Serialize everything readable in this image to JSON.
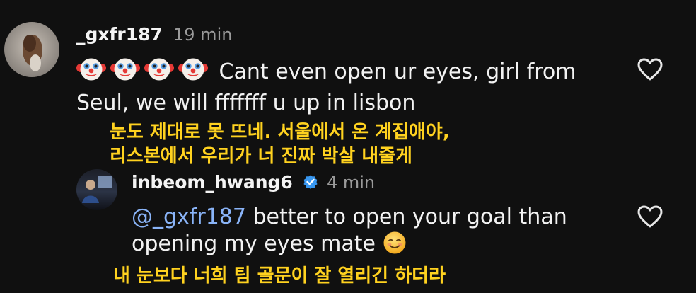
{
  "comments": [
    {
      "username": "_gxfr187",
      "time": "19 min",
      "emojis": [
        "clown-face",
        "clown-face",
        "clown-face",
        "clown-face"
      ],
      "text": "Cant even open ur eyes, girl from Seul, we will fffffff u up in lisbon",
      "subtitle_lines": [
        "눈도 제대로 못 뜨네. 서울에서 온 계집애야,",
        "리스본에서 우리가 너 진짜 박살 내줄게"
      ]
    },
    {
      "username": "inbeom_hwang6",
      "verified": true,
      "time": "4 min",
      "mention": "@_gxfr187",
      "text": " better to open your goal than opening my eyes mate",
      "emoji": "smiling-face",
      "subtitle_lines": [
        "내 눈보다 너희 팀 골문이 잘 열리긴 하더라"
      ]
    }
  ],
  "colors": {
    "background": "#101010",
    "subtitle": "#ffd21f",
    "mention": "#8ab4f8",
    "verified": "#3897f0"
  }
}
